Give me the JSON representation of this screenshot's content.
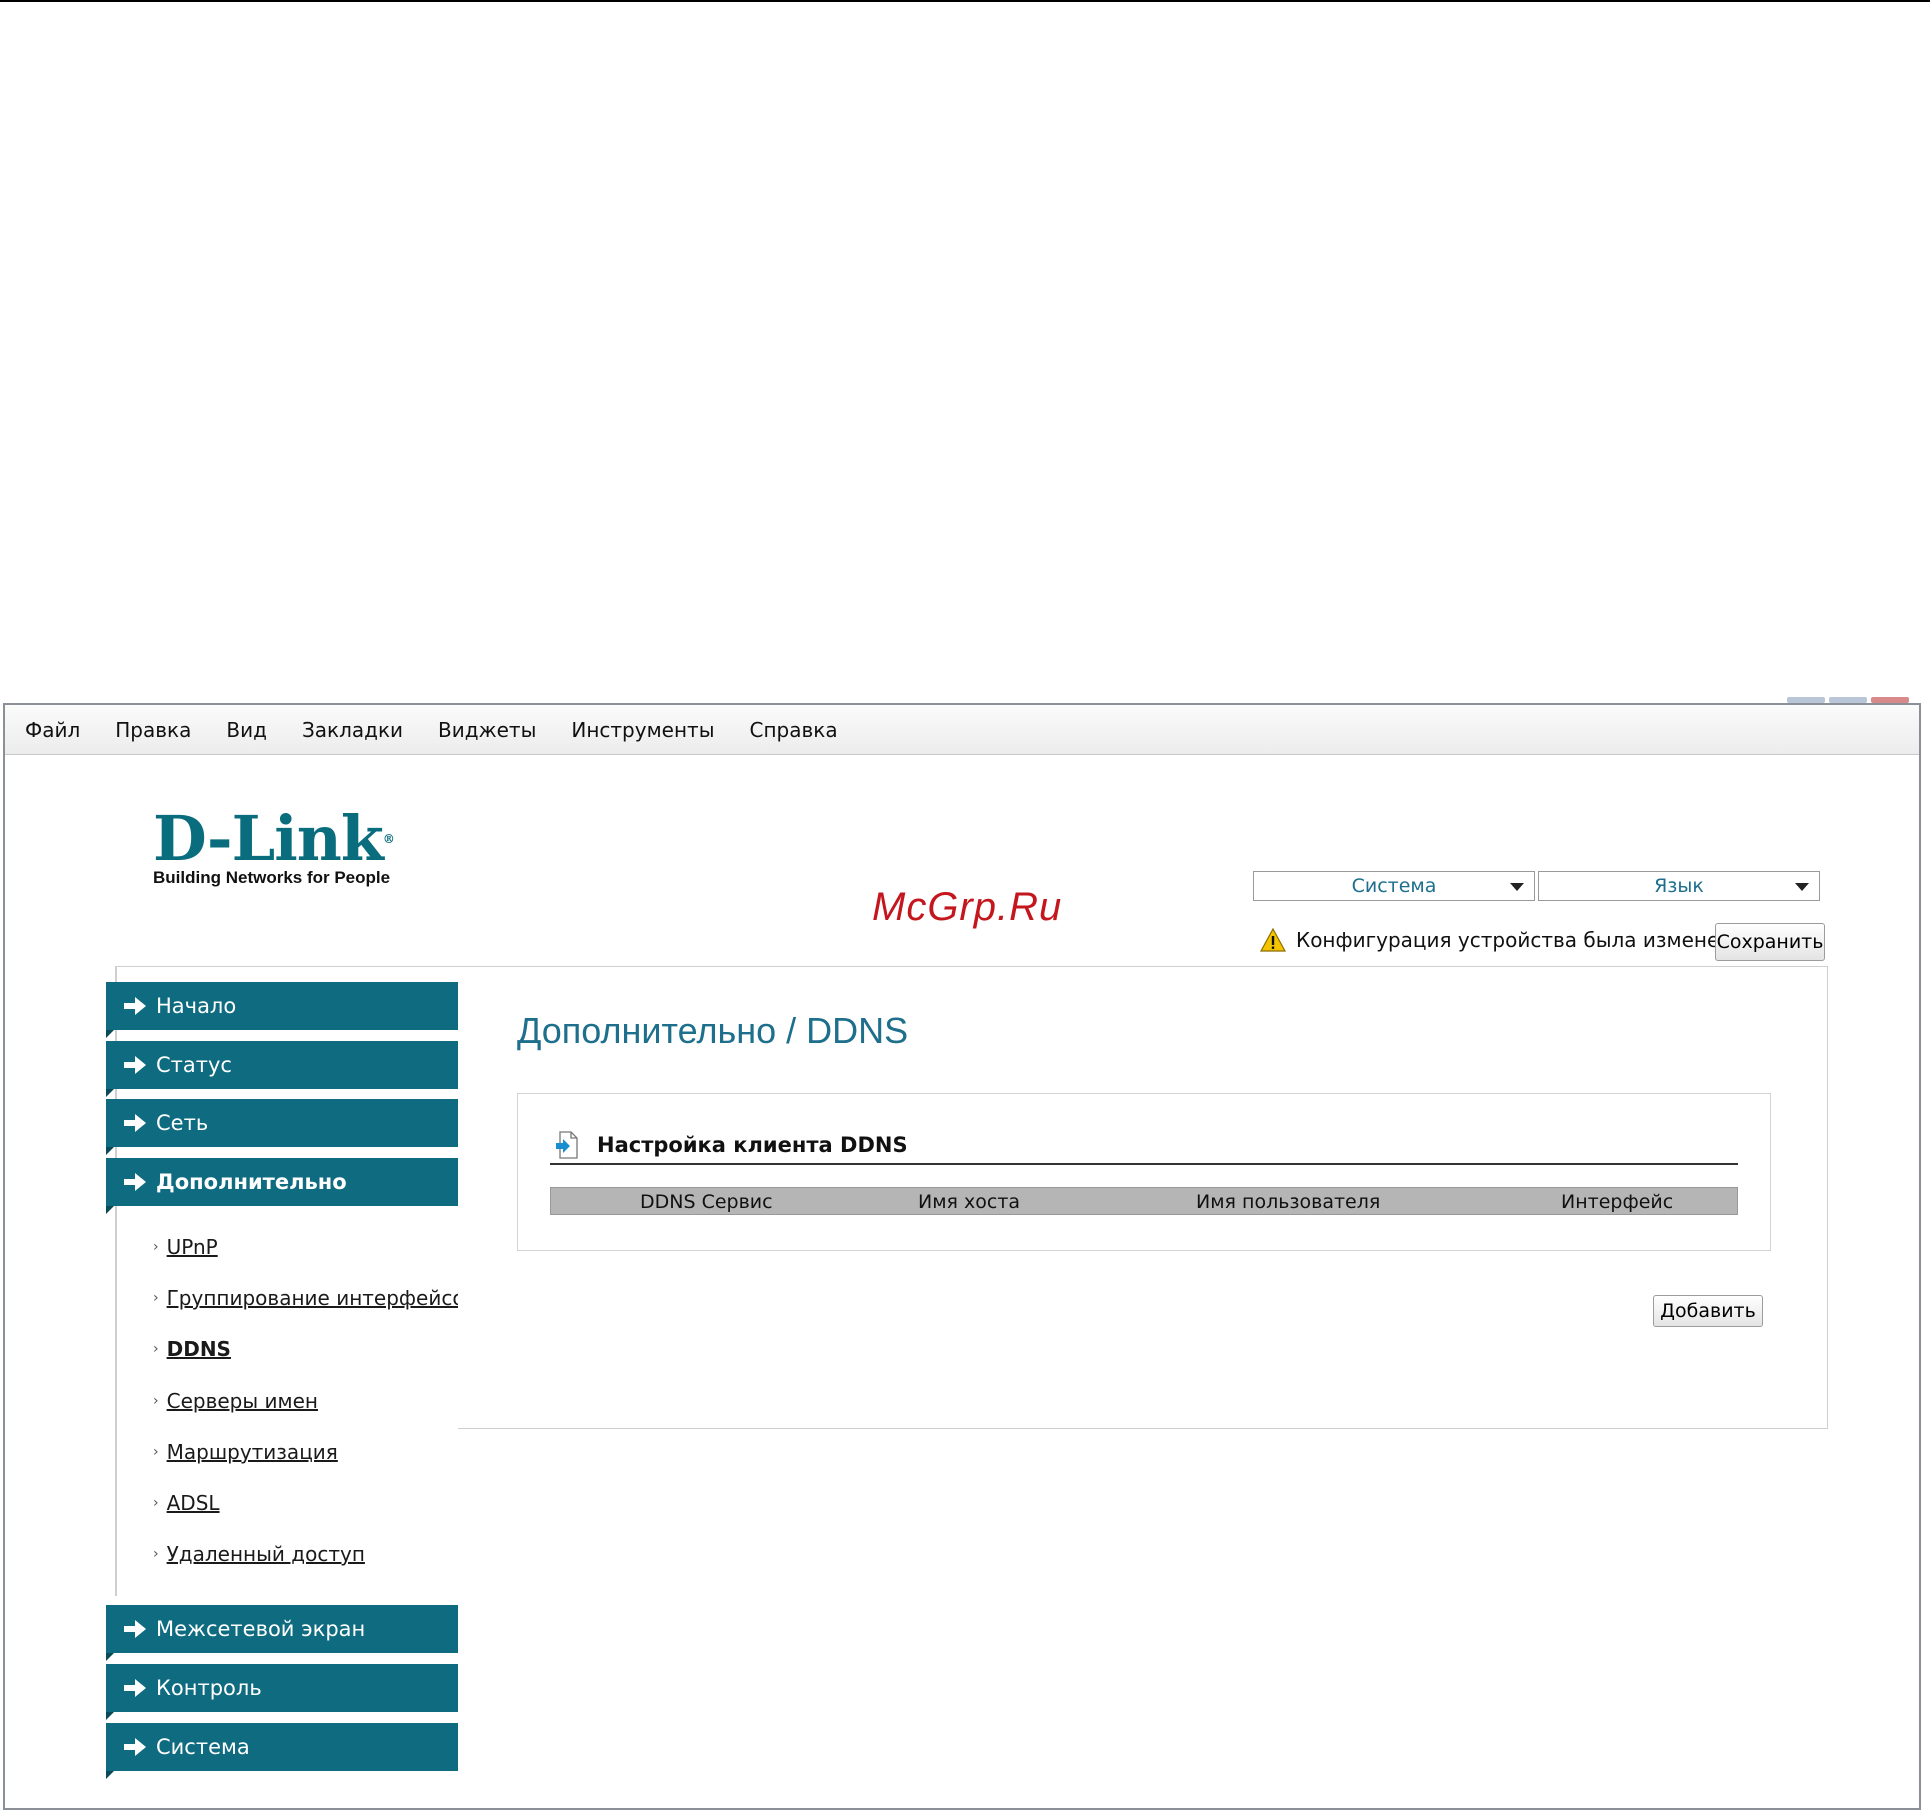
{
  "menu": [
    "Файл",
    "Правка",
    "Вид",
    "Закладки",
    "Виджеты",
    "Инструменты",
    "Справка"
  ],
  "logo": {
    "brand": "D-Link",
    "tagline": "Building Networks for People"
  },
  "watermark": "McGrp.Ru",
  "selects": {
    "system": "Система",
    "language": "Язык"
  },
  "notice": {
    "text": "Конфигурация устройства была изменена",
    "save_label": "Сохранить"
  },
  "nav": {
    "home": "Начало",
    "status": "Статус",
    "network": "Сеть",
    "advanced": "Дополнительно",
    "sub": [
      "UPnP",
      "Группирование интерфейсов",
      "DDNS",
      "Серверы имен",
      "Маршрутизация",
      "ADSL",
      "Удаленный доступ"
    ],
    "firewall": "Межсетевой экран",
    "control": "Контроль",
    "system": "Система"
  },
  "page": {
    "title": "Дополнительно /  DDNS",
    "section_title": "Настройка клиента DDNS",
    "columns": [
      "DDNS Сервис",
      "Имя хоста",
      "Имя пользователя",
      "Интерфейс"
    ],
    "add_label": "Добавить"
  },
  "colors": {
    "accent": "#0f6b80",
    "link": "#1d6f8c",
    "watermark": "#c4171d"
  }
}
